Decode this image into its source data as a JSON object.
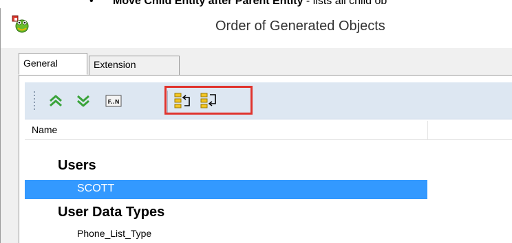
{
  "doc": {
    "bullet": "•",
    "bold_text": "Move Child Entity after Parent Entity",
    "rest_text": " - lists all child ob"
  },
  "window": {
    "title": "Order of Generated Objects",
    "app_icon": "frog-app-icon"
  },
  "tabs": [
    {
      "label": "General",
      "active": true
    },
    {
      "label": "Extension",
      "active": false
    }
  ],
  "toolbar": {
    "buttons": [
      {
        "icon": "move-up-icon"
      },
      {
        "icon": "move-down-icon"
      },
      {
        "icon": "first-last-icon",
        "label": "F..N"
      },
      {
        "icon": "move-child-after-parent-icon"
      },
      {
        "icon": "move-parent-before-child-icon"
      }
    ],
    "highlight_color": "#e0332d"
  },
  "list": {
    "column_name": "Name",
    "groups": [
      {
        "label": "Users",
        "items": [
          "SCOTT"
        ]
      },
      {
        "label": "User Data Types",
        "items": [
          "Phone_List_Type"
        ]
      }
    ],
    "selected_item": "SCOTT",
    "selection_color": "#3399ff"
  }
}
